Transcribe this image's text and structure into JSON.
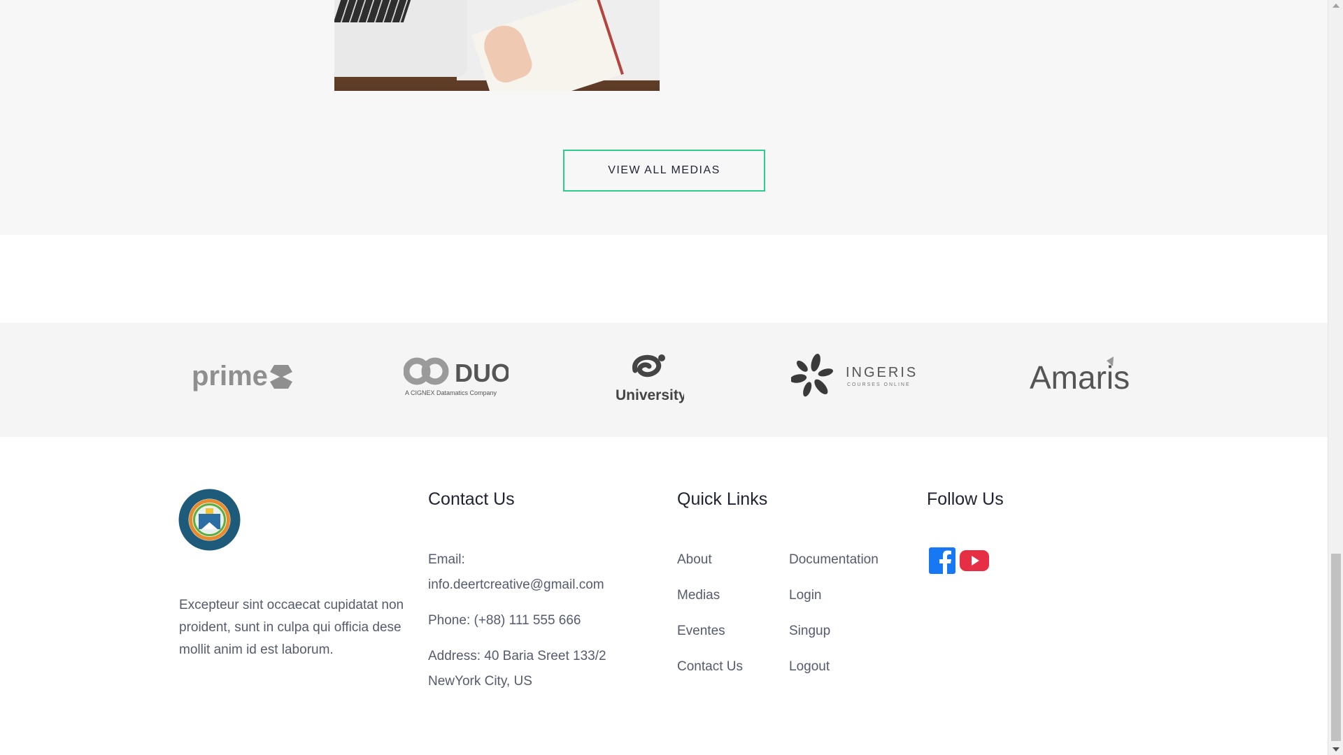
{
  "media": {
    "view_all_label": "VIEW ALL MEDIAS",
    "accent_color": "#2ecc8f"
  },
  "partners": {
    "logos": [
      {
        "name": "prime",
        "text": "prime"
      },
      {
        "name": "duo",
        "text": "DUO",
        "subtext": "A CIGNEX Datamatics Company"
      },
      {
        "name": "university",
        "text": "University"
      },
      {
        "name": "ingeris",
        "text": "INGERIS",
        "subtext": "COURSES ONLINE"
      },
      {
        "name": "amaris",
        "text": "Amaris"
      }
    ]
  },
  "footer": {
    "about_text": "Excepteur sint occaecat cupidatat non proident, sunt in culpa qui officia dese mollit anim id est laborum.",
    "contact": {
      "title": "Contact Us",
      "email_label": "Email:",
      "email": "info.deertcreative@gmail.com",
      "phone": "Phone: (+88) 111 555 666",
      "address_line1": "Address: 40 Baria Sreet 133/2",
      "address_line2": "NewYork City, US"
    },
    "quick_links": {
      "title": "Quick Links",
      "col1": [
        "About",
        "Medias",
        "Eventes",
        "Contact Us"
      ],
      "col2": [
        "Documentation",
        "Login",
        "Singup",
        "Logout"
      ]
    },
    "follow": {
      "title": "Follow Us",
      "icons": [
        "facebook-icon",
        "youtube-icon"
      ],
      "facebook_color": "#1877f2",
      "youtube_color": "#e62f44"
    }
  }
}
